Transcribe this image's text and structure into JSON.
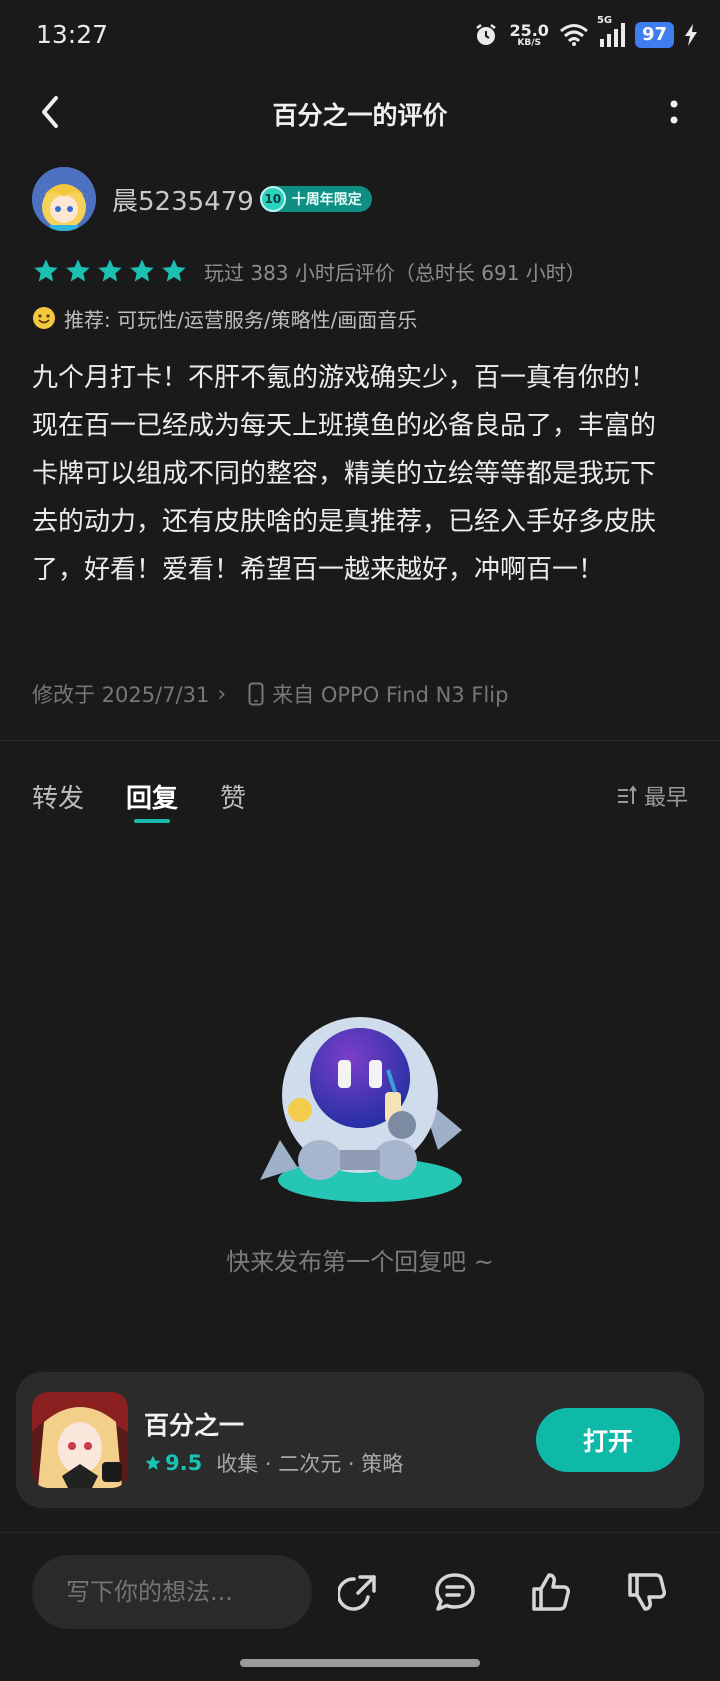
{
  "status_bar": {
    "time": "13:27",
    "net_speed_value": "25.0",
    "net_speed_unit": "KB/S",
    "signal_label": "5G",
    "battery": "97"
  },
  "nav": {
    "title": "百分之一的评价"
  },
  "author": {
    "name": "晨5235479",
    "badge_level": "10",
    "badge_label": "十周年限定"
  },
  "rating": {
    "stars": 5,
    "play_info": "玩过 383 小时后评价（总时长 691 小时）"
  },
  "recommend": {
    "text": "推荐: 可玩性/运营服务/策略性/画面音乐"
  },
  "review": {
    "body": "九个月打卡！不肝不氪的游戏确实少，百一真有你的！现在百一已经成为每天上班摸鱼的必备良品了，丰富的卡牌可以组成不同的整容，精美的立绘等等都是我玩下去的动力，还有皮肤啥的是真推荐，已经入手好多皮肤了，好看！爱看！希望百一越来越好，冲啊百一！"
  },
  "meta": {
    "modified": "修改于 2025/7/31",
    "device": "来自 OPPO Find N3 Flip"
  },
  "tabs": [
    {
      "label": "转发"
    },
    {
      "label": "回复"
    },
    {
      "label": "赞"
    }
  ],
  "sort": {
    "label": "最早"
  },
  "empty_state": {
    "text": "快来发布第一个回复吧 ~"
  },
  "game_card": {
    "name": "百分之一",
    "score": "9.5",
    "tags": "收集 · 二次元 · 策略",
    "open_label": "打开"
  },
  "bottom_bar": {
    "input_placeholder": "写下你的想法..."
  },
  "colors": {
    "background": "#1a1a1a",
    "accent": "#19b8aa",
    "star": "#1cc1b2",
    "battery": "#3f7df0"
  }
}
